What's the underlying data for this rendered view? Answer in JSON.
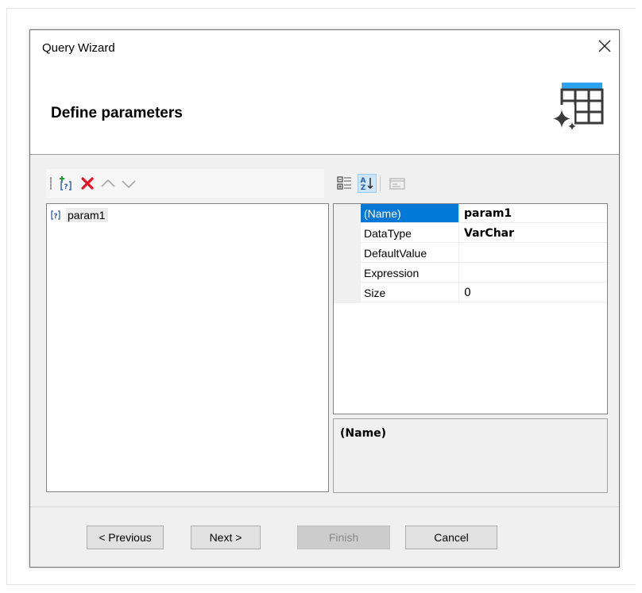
{
  "window": {
    "title": "Query Wizard",
    "close_icon": "close-icon"
  },
  "header": {
    "subtitle": "Define parameters",
    "icon": "table-sparkle-icon",
    "accent_color": "#2ea3f2"
  },
  "left_toolbar": {
    "buttons": [
      {
        "name": "add-parameter-icon",
        "interactable": true
      },
      {
        "name": "delete-icon",
        "interactable": true,
        "color": "#e81123"
      },
      {
        "name": "move-up-icon",
        "interactable": true
      },
      {
        "name": "move-down-icon",
        "interactable": true
      }
    ]
  },
  "parameters": [
    {
      "label": "param1",
      "icon": "parameter-icon"
    }
  ],
  "right_toolbar": {
    "buttons": [
      {
        "name": "categorized-icon"
      },
      {
        "name": "sort-alphabetical-icon",
        "active": true
      },
      {
        "name": "property-pages-icon",
        "disabled": true
      }
    ]
  },
  "properties": [
    {
      "name": "(Name)",
      "value": "param1",
      "selected": true,
      "bold": true
    },
    {
      "name": "DataType",
      "value": "VarChar",
      "bold": true
    },
    {
      "name": "DefaultValue",
      "value": ""
    },
    {
      "name": "Expression",
      "value": ""
    },
    {
      "name": "Size",
      "value": "0"
    }
  ],
  "description": {
    "title": "(Name)"
  },
  "footer": {
    "previous": "< Previous",
    "next": "Next >",
    "finish": "Finish",
    "cancel": "Cancel"
  }
}
